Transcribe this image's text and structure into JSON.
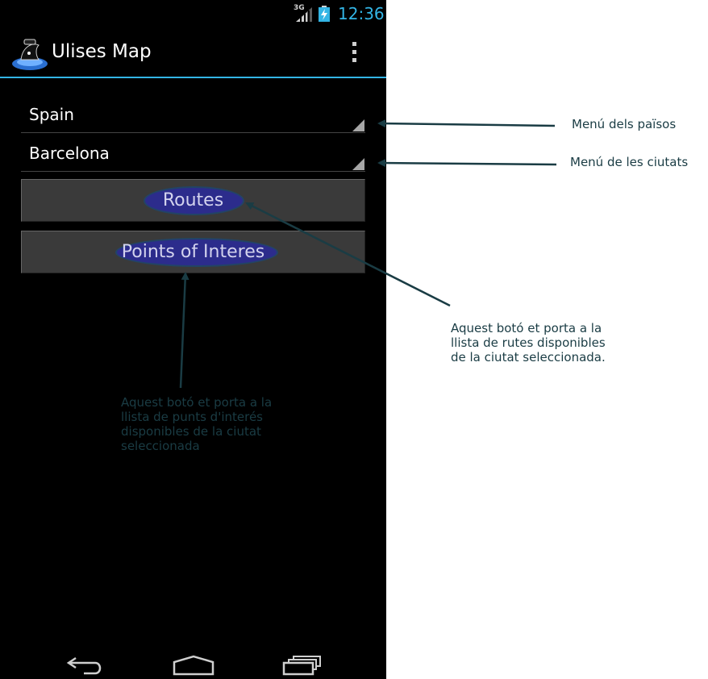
{
  "status": {
    "network": "3G",
    "time": "12:36"
  },
  "app": {
    "title": "Ulises Map"
  },
  "spinners": {
    "country": "Spain",
    "city": "Barcelona"
  },
  "buttons": {
    "routes": "Routes",
    "poi": "Points of Interes"
  },
  "annotations": {
    "country_menu": "Menú dels països",
    "city_menu": "Menú de les ciutats",
    "routes_note": [
      "Aquest botó et porta a la",
      "llista de rutes disponibles",
      "de la ciutat seleccionada."
    ],
    "poi_note": [
      "Aquest botó et porta a la",
      "llista de punts d'interés",
      "disponibles de la ciutat",
      "seleccionada"
    ]
  },
  "icons": {
    "signal": "signal-icon",
    "battery": "battery-icon",
    "app": "ulises-map-logo-icon",
    "overflow": "overflow-menu-icon",
    "back": "back-icon",
    "home": "home-icon",
    "recents": "recent-apps-icon"
  },
  "colors": {
    "accent": "#33b5e5",
    "annotation": "#1a3c44",
    "button_highlight": "#2c2c8c"
  }
}
